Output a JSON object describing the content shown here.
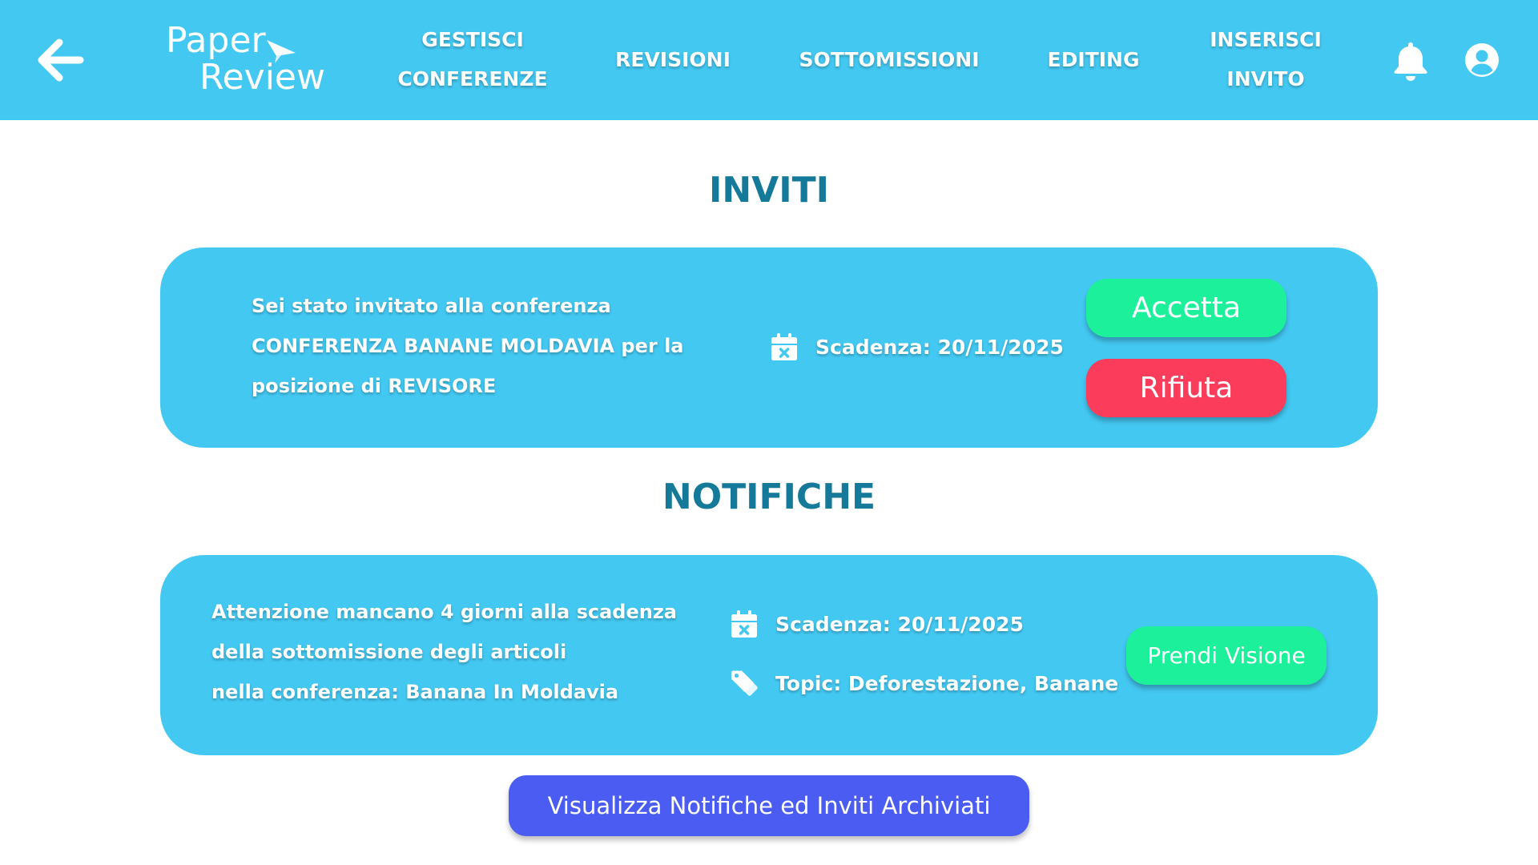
{
  "header": {
    "logo": {
      "line1": "Paper",
      "line2": "Review"
    },
    "nav": [
      {
        "lines": [
          "GESTISCI",
          "CONFERENZE"
        ]
      },
      {
        "lines": [
          "REVISIONI"
        ]
      },
      {
        "lines": [
          "SOTTOMISSIONI"
        ]
      },
      {
        "lines": [
          "EDITING"
        ]
      },
      {
        "lines": [
          "INSERISCI",
          "INVITO"
        ]
      }
    ],
    "icons": {
      "back": "arrow-left-icon",
      "notifications": "bell-icon",
      "account": "user-circle-icon"
    }
  },
  "inviti": {
    "title": "INVITI",
    "card": {
      "message_lines": [
        "Sei stato invitato  alla conferenza",
        "CONFERENZA BANANE MOLDAVIA per la",
        "posizione di REVISORE"
      ],
      "deadline": "Scadenza: 20/11/2025",
      "deadline_icon": "calendar-x-icon",
      "accept_label": "Accetta",
      "reject_label": "Rifiuta"
    }
  },
  "notifiche": {
    "title": "NOTIFICHE",
    "card": {
      "message_lines": [
        "Attenzione mancano 4 giorni alla  scadenza",
        "della sottomissione degli articoli",
        "nella conferenza: Banana In Moldavia"
      ],
      "deadline": "Scadenza: 20/11/2025",
      "deadline_icon": "calendar-x-icon",
      "topic": "Topic: Deforestazione, Banane",
      "topic_icon": "tags-icon",
      "action_label": "Prendi Visione"
    }
  },
  "archive_button_label": "Visualizza Notifiche ed Inviti Archiviati",
  "colors": {
    "header": "#43c8f2",
    "card": "#43c8f2",
    "title": "#157a9a",
    "accept": "#1df09a",
    "reject": "#fb3c5a",
    "archive": "#4a5cf2"
  }
}
